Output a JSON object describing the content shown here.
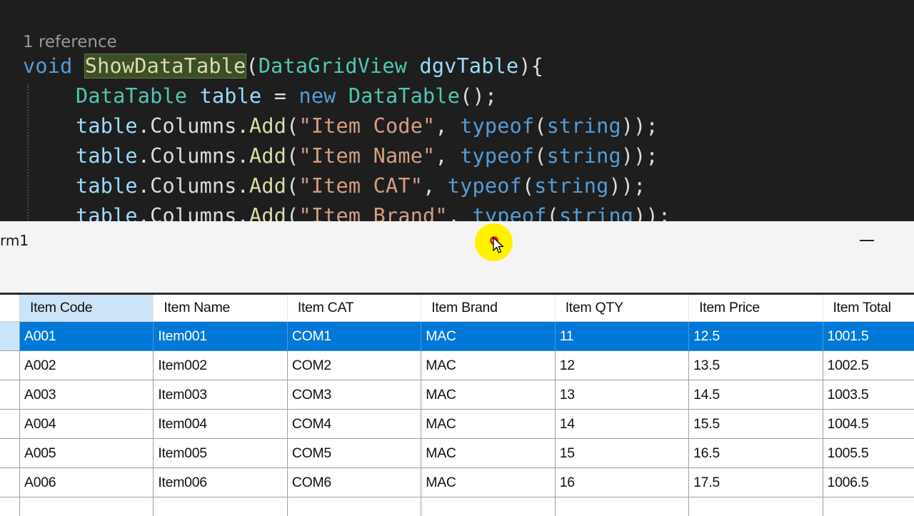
{
  "editor": {
    "codelens": "1 reference",
    "line1": {
      "kw_void": "void",
      "method": "ShowDataTable",
      "paren_open": "(",
      "param_type": "DataGridView",
      "param_name": "dgvTable",
      "tail": "){"
    },
    "line2": {
      "type": "DataTable",
      "var": "table",
      "eq": " = ",
      "kw_new": "new",
      "ctor": "DataTable",
      "tail": "();"
    },
    "column_lines": [
      {
        "obj": "table",
        "mid": ".Columns.",
        "fn": "Add",
        "open": "(",
        "str": "\"Item Code\"",
        "comma": ", ",
        "kw": "typeof",
        "arg_open": "(",
        "kw2": "string",
        "close": "));"
      },
      {
        "obj": "table",
        "mid": ".Columns.",
        "fn": "Add",
        "open": "(",
        "str": "\"Item Name\"",
        "comma": ", ",
        "kw": "typeof",
        "arg_open": "(",
        "kw2": "string",
        "close": "));"
      },
      {
        "obj": "table",
        "mid": ".Columns.",
        "fn": "Add",
        "open": "(",
        "str": "\"Item CAT\"",
        "comma": ", ",
        "kw": "typeof",
        "arg_open": "(",
        "kw2": "string",
        "close": "));"
      },
      {
        "obj": "table",
        "mid": ".Columns.",
        "fn": "Add",
        "open": "(",
        "str": "\"Item Brand\"",
        "comma": ", ",
        "kw": "typeof",
        "arg_open": "(",
        "kw2": "string",
        "close": "));"
      }
    ]
  },
  "form": {
    "title": "rm1",
    "minimize_label": "—"
  },
  "grid": {
    "columns": [
      "Item Code",
      "Item Name",
      "Item CAT",
      "Item Brand",
      "Item QTY",
      "Item Price",
      "Item Total"
    ],
    "rows": [
      [
        "A001",
        "Item001",
        "COM1",
        "MAC",
        "11",
        "12.5",
        "1001.5"
      ],
      [
        "A002",
        "Item002",
        "COM2",
        "MAC",
        "12",
        "13.5",
        "1002.5"
      ],
      [
        "A003",
        "Item003",
        "COM3",
        "MAC",
        "13",
        "14.5",
        "1003.5"
      ],
      [
        "A004",
        "Item004",
        "COM4",
        "MAC",
        "14",
        "15.5",
        "1004.5"
      ],
      [
        "A005",
        "Item005",
        "COM5",
        "MAC",
        "15",
        "16.5",
        "1005.5"
      ],
      [
        "A006",
        "Item006",
        "COM6",
        "MAC",
        "16",
        "17.5",
        "1006.5"
      ],
      [
        "",
        "",
        "",
        "",
        "",
        "",
        ""
      ]
    ],
    "selected_row": 0
  },
  "colors": {
    "selection": "#0078d7",
    "header_highlight": "#cce4f7",
    "cursor_highlight": "#fff200"
  }
}
